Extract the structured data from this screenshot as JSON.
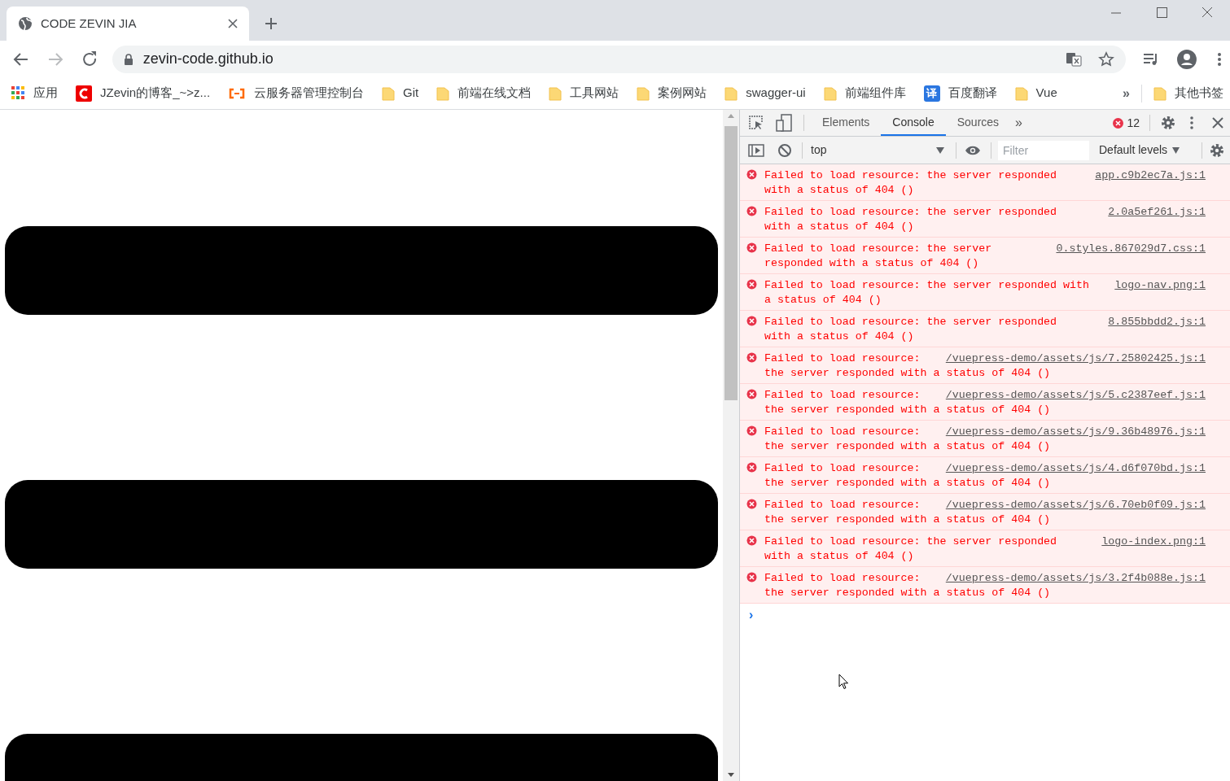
{
  "tabs": [
    {
      "title": "CODE ZEVIN JIA",
      "selected": true
    }
  ],
  "address": {
    "url": "zevin-code.github.io"
  },
  "bookmarks": [
    {
      "label": "应用",
      "kind": "apps"
    },
    {
      "label": "JZevin的博客_~>z...",
      "kind": "red-site"
    },
    {
      "label": "云服务器管理控制台",
      "kind": "cloud"
    },
    {
      "label": "Git",
      "kind": "folder"
    },
    {
      "label": "前端在线文档",
      "kind": "folder"
    },
    {
      "label": "工具网站",
      "kind": "folder"
    },
    {
      "label": "案例网站",
      "kind": "folder"
    },
    {
      "label": "swagger-ui",
      "kind": "folder"
    },
    {
      "label": "前端组件库",
      "kind": "folder"
    },
    {
      "label": "百度翻译",
      "kind": "translate",
      "badge": "译"
    },
    {
      "label": "Vue",
      "kind": "folder"
    }
  ],
  "bookmarks_overflow": "»",
  "other_bookmarks": {
    "label": "其他书签"
  },
  "page": {
    "blocks": [
      {
        "kind": "block"
      },
      {
        "kind": "block"
      },
      {
        "kind": "block"
      }
    ]
  },
  "devtools": {
    "tabs": [
      {
        "label": "Elements",
        "selected": false
      },
      {
        "label": "Console",
        "selected": true
      },
      {
        "label": "Sources",
        "selected": false
      }
    ],
    "more_tabs": "»",
    "error_count": "12",
    "context": "top",
    "filter": {
      "placeholder": "Filter"
    },
    "levels": "Default levels",
    "messages": [
      {
        "lines": [
          "Failed to load resource: the server responded",
          "with a status of 404 ()"
        ],
        "source": "app.c9b2ec7a.js:1"
      },
      {
        "lines": [
          "Failed to load resource: the server responded",
          "with a status of 404 ()"
        ],
        "source": "2.0a5ef261.js:1"
      },
      {
        "lines": [
          "Failed to load resource: the server",
          "responded with a status of 404 ()"
        ],
        "source": "0.styles.867029d7.css:1"
      },
      {
        "lines": [
          "Failed to load resource: the server responded with",
          "a status of 404 ()"
        ],
        "source": "logo-nav.png:1"
      },
      {
        "lines": [
          "Failed to load resource: the server responded",
          "with a status of 404 ()"
        ],
        "source": "8.855bbdd2.js:1"
      },
      {
        "lines": [
          "Failed to load resource:",
          "the server responded with a status of 404 ()"
        ],
        "source": "/vuepress-demo/assets/js/7.25802425.js:1"
      },
      {
        "lines": [
          "Failed to load resource:",
          "the server responded with a status of 404 ()"
        ],
        "source": "/vuepress-demo/assets/js/5.c2387eef.js:1"
      },
      {
        "lines": [
          "Failed to load resource:",
          "the server responded with a status of 404 ()"
        ],
        "source": "/vuepress-demo/assets/js/9.36b48976.js:1"
      },
      {
        "lines": [
          "Failed to load resource:",
          "the server responded with a status of 404 ()"
        ],
        "source": "/vuepress-demo/assets/js/4.d6f070bd.js:1"
      },
      {
        "lines": [
          "Failed to load resource:",
          "the server responded with a status of 404 ()"
        ],
        "source": "/vuepress-demo/assets/js/6.70eb0f09.js:1"
      },
      {
        "lines": [
          "Failed to load resource: the server responded",
          "with a status of 404 ()"
        ],
        "source": "logo-index.png:1"
      },
      {
        "lines": [
          "Failed to load resource:",
          "the server responded with a status of 404 ()"
        ],
        "source": "/vuepress-demo/assets/js/3.2f4b088e.js:1"
      }
    ],
    "prompt": "›"
  }
}
